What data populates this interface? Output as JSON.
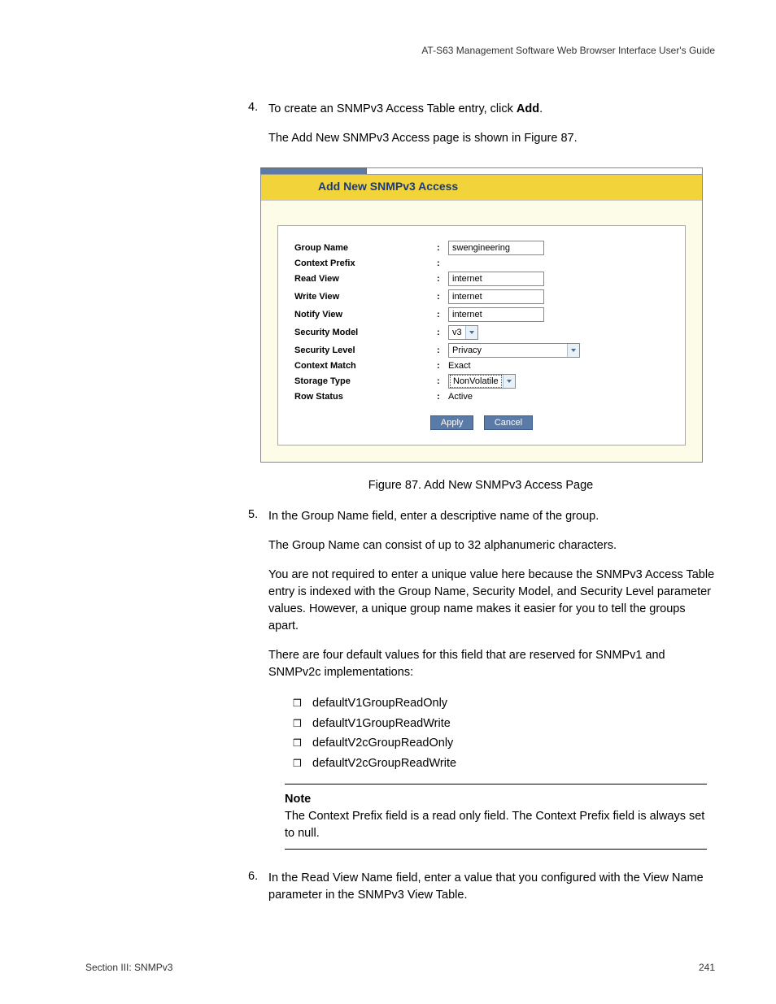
{
  "header": {
    "guide": "AT-S63 Management Software Web Browser Interface User's Guide"
  },
  "steps": {
    "s4": {
      "num": "4.",
      "text_prefix": "To create an SNMPv3 Access Table entry, click ",
      "text_bold": "Add",
      "text_suffix": ".",
      "sub": "The Add New SNMPv3 Access page is shown in Figure 87."
    },
    "s5": {
      "num": "5.",
      "text": "In the Group Name field, enter a descriptive name of the group.",
      "p1": "The Group Name can consist of up to 32 alphanumeric characters.",
      "p2": "You are not required to enter a unique value here because the SNMPv3 Access Table entry is indexed with the Group Name, Security Model, and Security Level parameter values. However, a unique group name makes it easier for you to tell the groups apart.",
      "p3": "There are four default values for this field that are reserved for SNMPv1 and SNMPv2c implementations:"
    },
    "s6": {
      "num": "6.",
      "text": "In the Read View Name field, enter a value that you configured with the View Name parameter in the SNMPv3 View Table."
    }
  },
  "figure": {
    "title": "Add New SNMPv3 Access",
    "caption": "Figure 87. Add New SNMPv3 Access Page",
    "rows": {
      "group_name": {
        "label": "Group Name",
        "value": "swengineering"
      },
      "context_prefix": {
        "label": "Context Prefix",
        "value": ""
      },
      "read_view": {
        "label": "Read View",
        "value": "internet"
      },
      "write_view": {
        "label": "Write View",
        "value": "internet"
      },
      "notify_view": {
        "label": "Notify View",
        "value": "internet"
      },
      "security_model": {
        "label": "Security Model",
        "value": "v3"
      },
      "security_level": {
        "label": "Security Level",
        "value": "Privacy"
      },
      "context_match": {
        "label": "Context Match",
        "value": "Exact"
      },
      "storage_type": {
        "label": "Storage Type",
        "value": "NonVolatile"
      },
      "row_status": {
        "label": "Row Status",
        "value": "Active"
      }
    },
    "buttons": {
      "apply": "Apply",
      "cancel": "Cancel"
    }
  },
  "bullets": {
    "b1": "defaultV1GroupReadOnly",
    "b2": "defaultV1GroupReadWrite",
    "b3": "defaultV2cGroupReadOnly",
    "b4": "defaultV2cGroupReadWrite"
  },
  "note": {
    "title": "Note",
    "body": "The Context Prefix field is a read only field. The Context Prefix field is always set to null."
  },
  "footer": {
    "section": "Section III: SNMPv3",
    "page": "241"
  }
}
